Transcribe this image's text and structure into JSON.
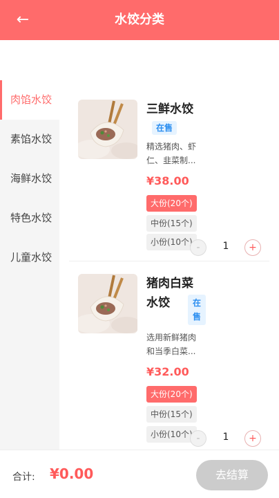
{
  "header": {
    "back_icon": "←",
    "title": "水饺分类"
  },
  "categories": [
    {
      "label": "肉馅水饺",
      "active": true
    },
    {
      "label": "素馅水饺",
      "active": false
    },
    {
      "label": "海鲜水饺",
      "active": false
    },
    {
      "label": "特色水饺",
      "active": false
    },
    {
      "label": "儿童水饺",
      "active": false
    }
  ],
  "products": [
    {
      "name": "三鲜水饺",
      "status": "在售",
      "description_lines": [
        "精选猪肉、虾",
        "仁、韭菜制..."
      ],
      "price": "¥38.00",
      "options": [
        "大份(20个)",
        "中份(15个)",
        "小份(10个)"
      ],
      "selected_option": "大份(20个)",
      "quantity": "1",
      "minus_label": "-",
      "plus_label": "+"
    },
    {
      "name_lines": [
        "猪肉白菜",
        "水饺"
      ],
      "status_lines": [
        "在",
        "售"
      ],
      "description_lines": [
        "选用新鲜猪肉",
        "和当季白菜..."
      ],
      "price": "¥32.00",
      "options": [
        "大份(20个)",
        "中份(15个)",
        "小份(10个)"
      ],
      "selected_option": "大份(20个)",
      "quantity": "1",
      "minus_label": "-",
      "plus_label": "+"
    }
  ],
  "footer": {
    "total_label": "合计:",
    "total_value": "¥0.00",
    "checkout_label": "去结算"
  },
  "colors": {
    "accent": "#ff6b6b",
    "price": "#ff5a5a",
    "badge_bg": "#e6f3ff",
    "badge_text": "#2b8ef0",
    "checkout_disabled": "#cccccc"
  }
}
